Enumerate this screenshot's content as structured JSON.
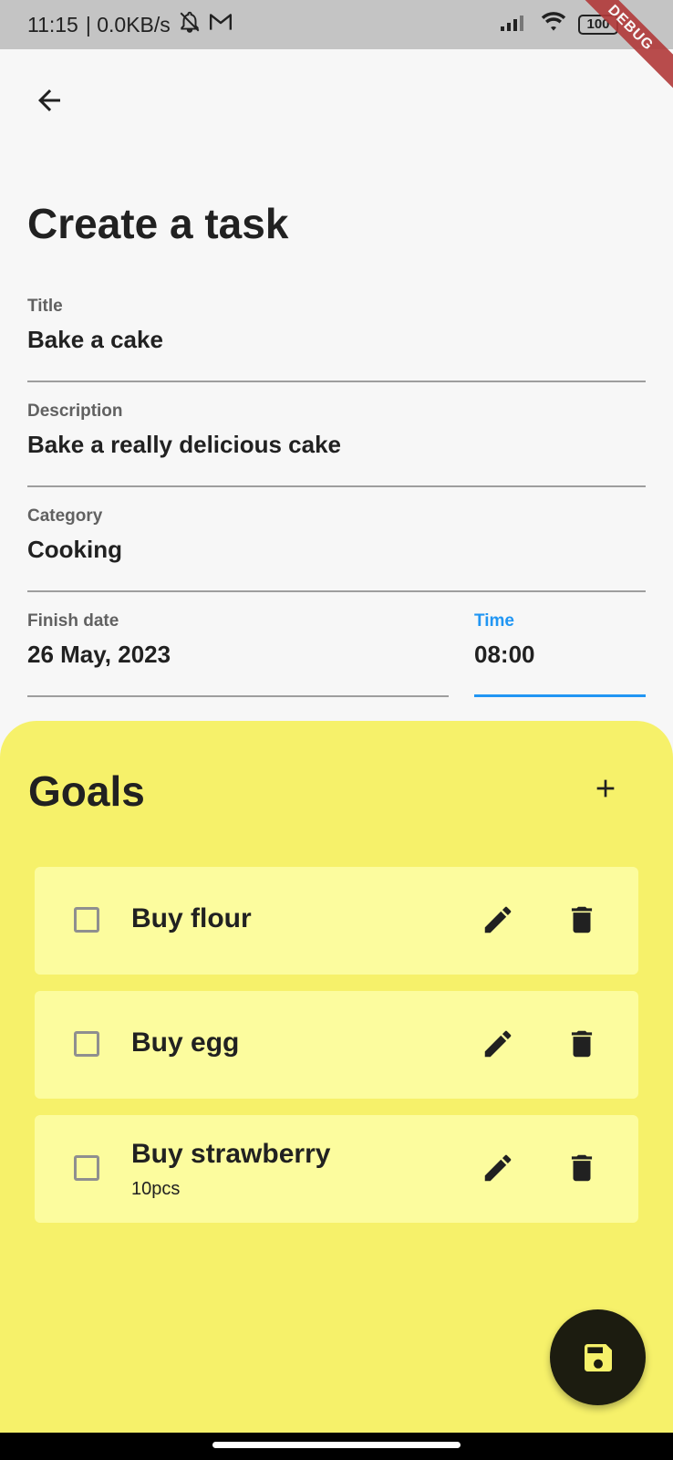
{
  "status_bar": {
    "time": "11:15",
    "network_speed": "| 0.0KB/s",
    "battery": "100",
    "debug_label": "DEBUG"
  },
  "header": {
    "title": "Create a task",
    "back_icon": "arrow-back-icon"
  },
  "form": {
    "title": {
      "label": "Title",
      "value": "Bake a cake"
    },
    "description": {
      "label": "Description",
      "value": "Bake a really delicious cake"
    },
    "category": {
      "label": "Category",
      "value": "Cooking"
    },
    "finish_date": {
      "label": "Finish date",
      "value": "26 May, 2023"
    },
    "time": {
      "label": "Time",
      "value": "08:00"
    }
  },
  "goals": {
    "title": "Goals",
    "items": [
      {
        "title": "Buy flour",
        "subtitle": "",
        "checked": false
      },
      {
        "title": "Buy egg",
        "subtitle": "",
        "checked": false
      },
      {
        "title": "Buy strawberry",
        "subtitle": "10pcs",
        "checked": false
      }
    ]
  },
  "colors": {
    "background": "#f7f7f7",
    "goals_panel": "#f6f16a",
    "goal_card": "#fcfc9e",
    "accent": "#2196f3",
    "fab": "#1c1c10",
    "fab_icon": "#f6f16a"
  }
}
